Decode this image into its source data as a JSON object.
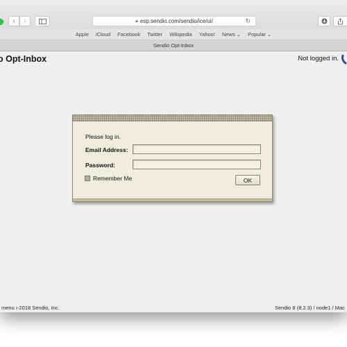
{
  "browser": {
    "url": "esp.sendio.com/sendio/ice/ui/",
    "tab_title": "Sendio Opt-Inbox",
    "favorites": [
      "Apple",
      "iCloud",
      "Facebook",
      "Twitter",
      "Wikipedia",
      "Yahoo!",
      "News ⌄",
      "Popular ⌄"
    ]
  },
  "header": {
    "app_title": "o Opt-Inbox",
    "login_status": "Not logged in."
  },
  "login": {
    "prompt": "Please log in.",
    "email_label": "Email Address:",
    "email_value": "",
    "password_label": "Password:",
    "password_value": "",
    "remember_label": "Remember Me",
    "remember_checked": false,
    "ok_label": "OK"
  },
  "footer": {
    "left": "menu  ı-2018 Sendio, Inc.",
    "right": "Sendio 8 (8.2.3) / node1 / Mac"
  },
  "colors": {
    "dialog_bg": "#f0ecde",
    "dialog_border": "#8e8671",
    "page_bg": "#efefef"
  }
}
